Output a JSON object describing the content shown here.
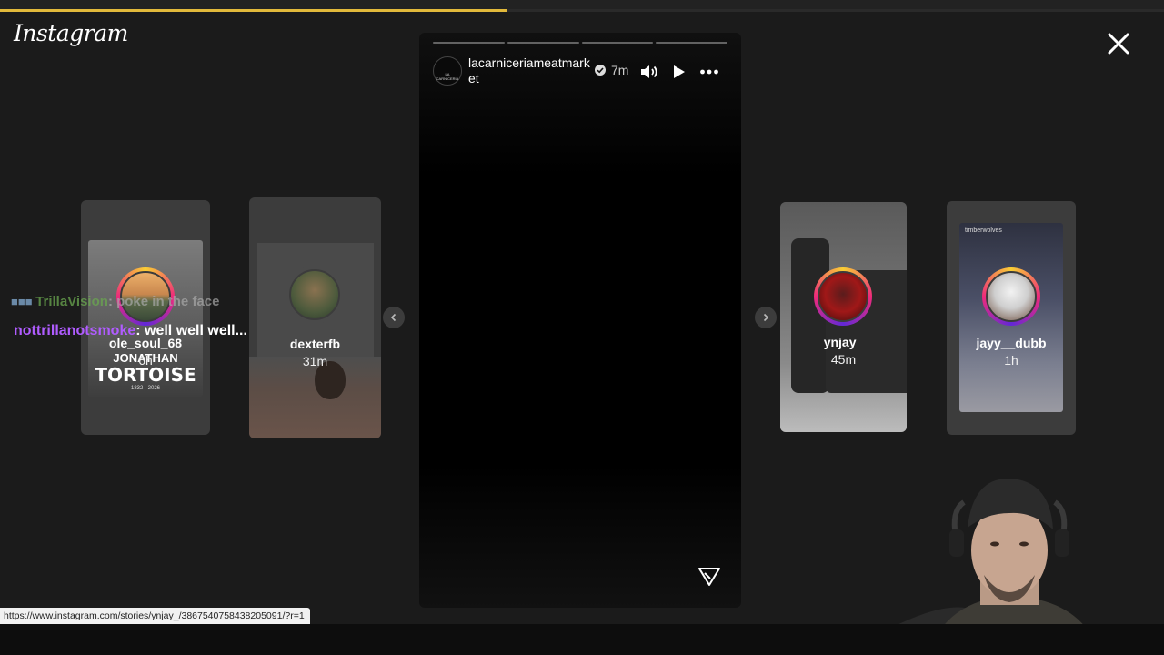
{
  "app": {
    "logo_text": "Instagram"
  },
  "story": {
    "username": "lacarniceriameatmarket",
    "time": "7m",
    "avatar_label": "LA CARNICERIA",
    "segments": 4
  },
  "cards": [
    {
      "username": "ole_soul_68",
      "time": "6h",
      "caption_top": "JONATHAN",
      "caption_main": "TORTOISE",
      "caption_dates": "1832 - 2026"
    },
    {
      "username": "dexterfb",
      "time": "31m"
    },
    {
      "username": "ynjay_",
      "time": "45m"
    },
    {
      "username": "jayy__dubb",
      "time": "1h",
      "overlay_text": "timberwolves"
    }
  ],
  "chat": [
    {
      "user": "TrillaVision",
      "message": ": poke in the face"
    },
    {
      "user": "nottrillanotsmoke",
      "message": ": well well well..."
    }
  ],
  "status_url": "https://www.instagram.com/stories/ynjay_/3867540758438205091/?r=1",
  "colors": {
    "background": "#1b1b1b",
    "story_ring_start": "#f9ce34",
    "story_ring_mid": "#ee2a7b",
    "chat_name_purple": "#b05cff",
    "chat_name_green": "#6aa84f",
    "progress_loaded": "#e2b93b"
  },
  "icons": [
    "close-icon",
    "verified-icon",
    "speaker-icon",
    "play-icon",
    "more-icon",
    "send-icon",
    "chevron-left-icon",
    "chevron-right-icon"
  ]
}
